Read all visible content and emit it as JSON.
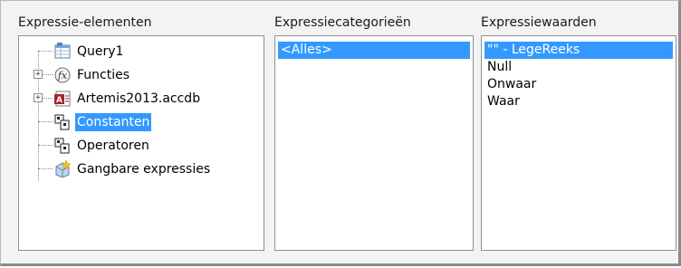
{
  "panels": {
    "elements": {
      "title": "Expressie-elementen"
    },
    "categories": {
      "title": "Expressiecategorieën"
    },
    "values": {
      "title": "Expressiewaarden"
    }
  },
  "tree": [
    {
      "label": "Query1",
      "icon": "query-icon",
      "expandable": false,
      "selected": false
    },
    {
      "label": "Functies",
      "icon": "function-icon",
      "expandable": true,
      "selected": false
    },
    {
      "label": "Artemis2013.accdb",
      "icon": "database-icon",
      "expandable": true,
      "selected": false
    },
    {
      "label": "Constanten",
      "icon": "constants-icon",
      "expandable": false,
      "selected": true
    },
    {
      "label": "Operatoren",
      "icon": "operators-icon",
      "expandable": false,
      "selected": false
    },
    {
      "label": "Gangbare expressies",
      "icon": "common-expressions-icon",
      "expandable": false,
      "selected": false
    }
  ],
  "categories": [
    {
      "label": "<Alles>",
      "selected": true
    }
  ],
  "values": [
    {
      "label": "\"\" - LegeReeks",
      "selected": true
    },
    {
      "label": "Null",
      "selected": false
    },
    {
      "label": "Onwaar",
      "selected": false
    },
    {
      "label": "Waar",
      "selected": false
    }
  ],
  "colors": {
    "selection": "#3399ff",
    "border": "#8f8f8f",
    "background": "#f3f3f3"
  }
}
